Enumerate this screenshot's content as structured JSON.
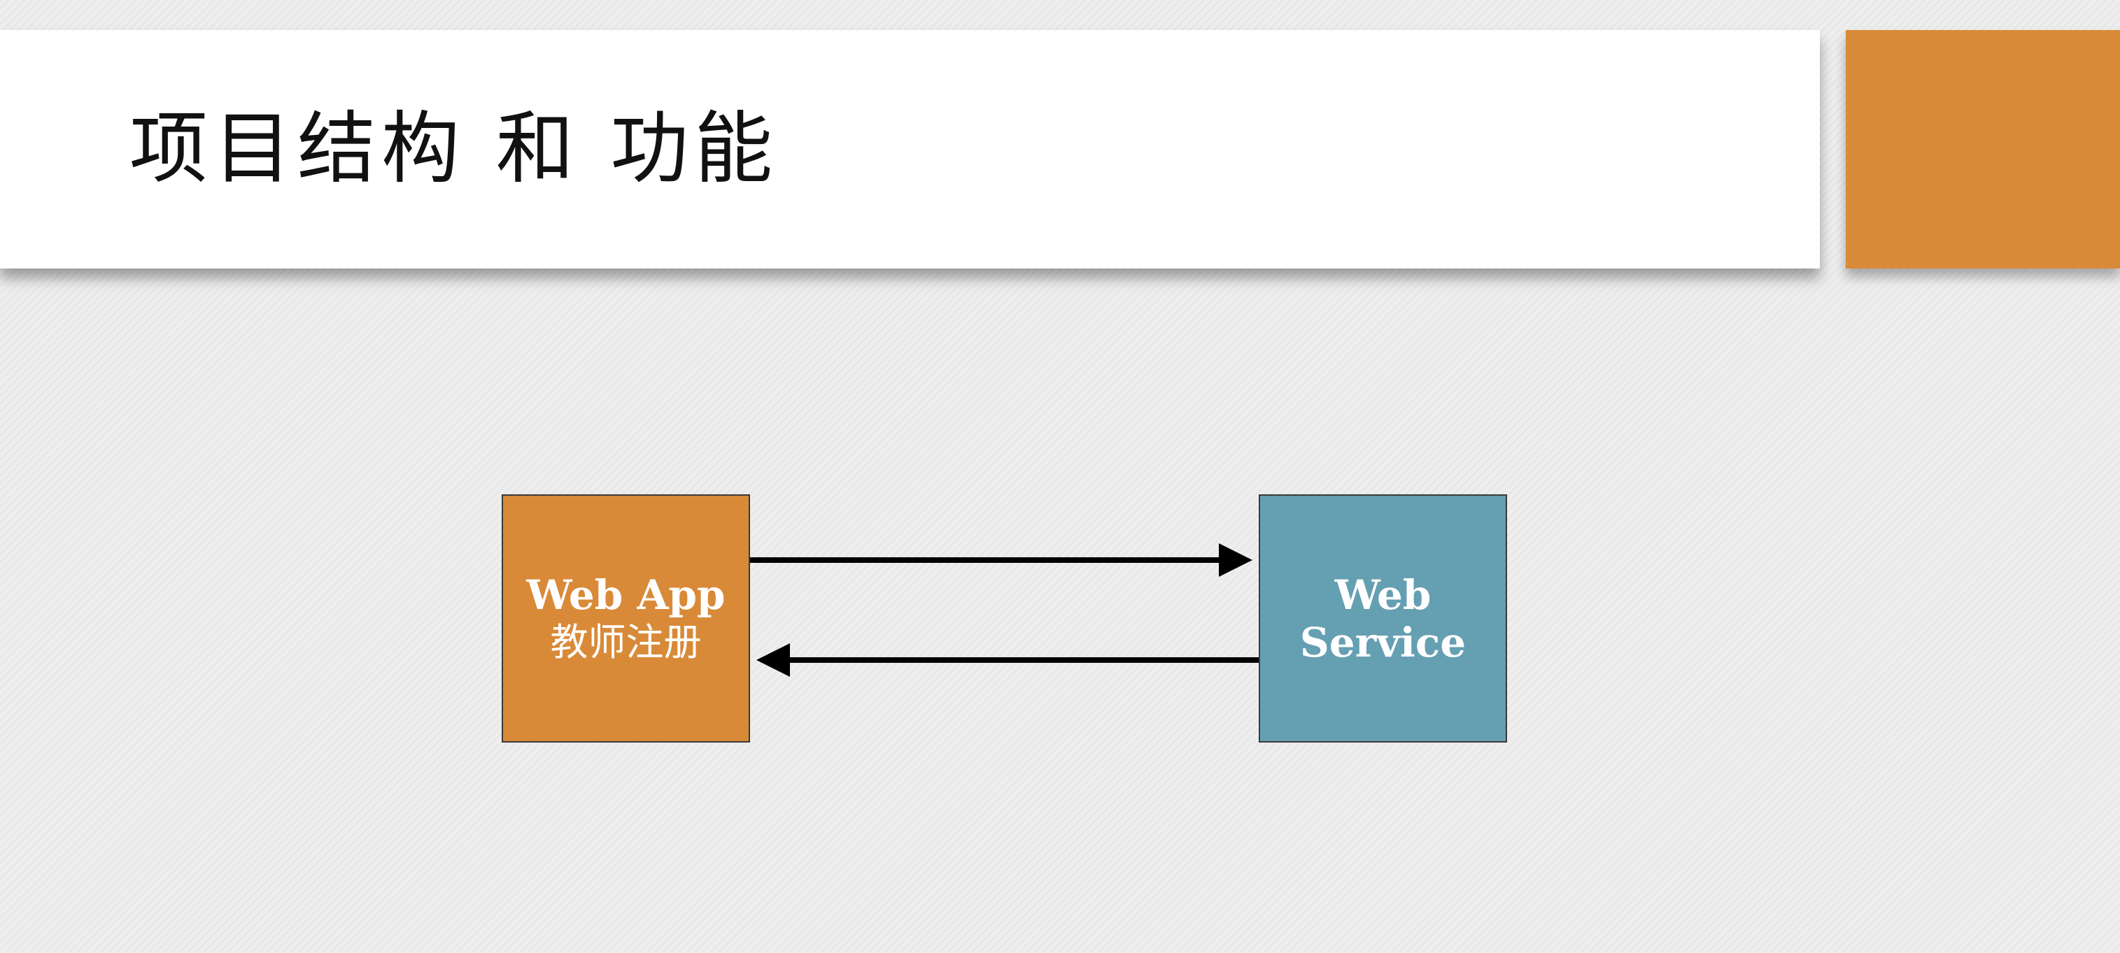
{
  "slide": {
    "title": "项目结构 和 功能"
  },
  "colors": {
    "accent_orange": "#d98a38",
    "service_blue": "#659fb2",
    "arrow": "#000000"
  },
  "diagram": {
    "nodes": {
      "web_app": {
        "title": "Web App",
        "subtitle": "教师注册"
      },
      "web_service": {
        "title_line1": "Web",
        "title_line2": "Service"
      }
    },
    "edges": [
      {
        "from": "web_app",
        "to": "web_service",
        "direction": "right"
      },
      {
        "from": "web_service",
        "to": "web_app",
        "direction": "left"
      }
    ]
  }
}
